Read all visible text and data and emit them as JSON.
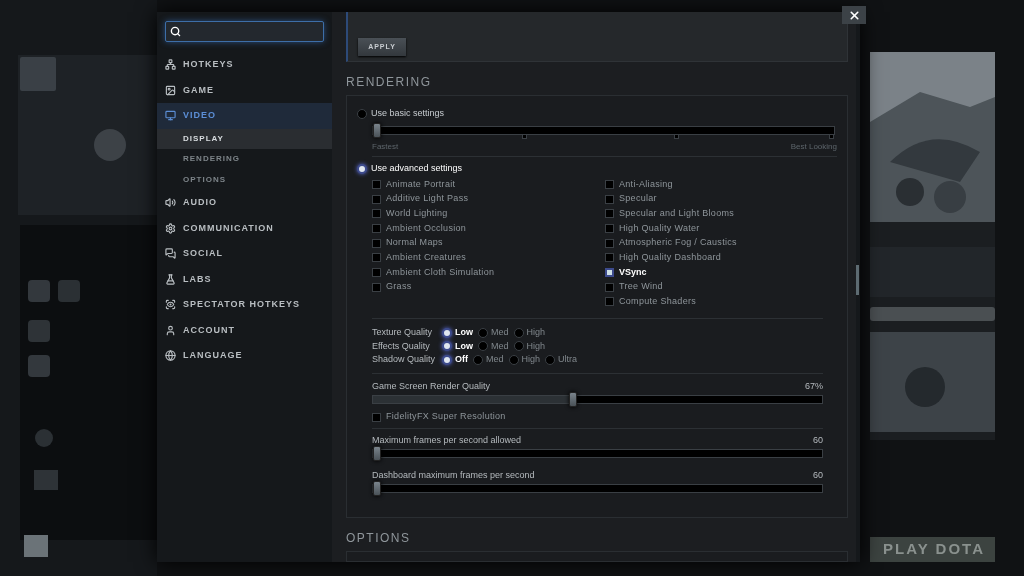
{
  "sidebar": {
    "items": [
      {
        "label": "HOTKEYS",
        "kind": "hotkeys",
        "selected": false
      },
      {
        "label": "GAME",
        "kind": "game",
        "selected": false
      },
      {
        "label": "VIDEO",
        "kind": "video",
        "selected": true,
        "children": [
          {
            "label": "DISPLAY",
            "selected": true
          },
          {
            "label": "RENDERING",
            "selected": false
          },
          {
            "label": "OPTIONS",
            "selected": false
          }
        ]
      },
      {
        "label": "AUDIO",
        "kind": "audio",
        "selected": false
      },
      {
        "label": "COMMUNICATION",
        "kind": "communication",
        "selected": false
      },
      {
        "label": "SOCIAL",
        "kind": "social",
        "selected": false
      },
      {
        "label": "LABS",
        "kind": "labs",
        "selected": false
      },
      {
        "label": "SPECTATOR HOTKEYS",
        "kind": "spectator",
        "selected": false
      },
      {
        "label": "ACCOUNT",
        "kind": "account",
        "selected": false
      },
      {
        "label": "LANGUAGE",
        "kind": "language",
        "selected": false
      }
    ]
  },
  "apply_button": "APPLY",
  "rendering": {
    "title": "RENDERING",
    "basic": {
      "label": "Use basic settings",
      "selected": false,
      "level": 0,
      "min_label": "Fastest",
      "max_label": "Best Looking"
    },
    "advanced": {
      "label": "Use advanced settings",
      "selected": true
    },
    "checkboxes_left": [
      {
        "label": "Animate Portrait",
        "checked": false
      },
      {
        "label": "Additive Light Pass",
        "checked": false
      },
      {
        "label": "World Lighting",
        "checked": false
      },
      {
        "label": "Ambient Occlusion",
        "checked": false
      },
      {
        "label": "Normal Maps",
        "checked": false
      },
      {
        "label": "Ambient Creatures",
        "checked": false
      },
      {
        "label": "Ambient Cloth Simulation",
        "checked": false
      },
      {
        "label": "Grass",
        "checked": false
      }
    ],
    "checkboxes_right": [
      {
        "label": "Anti-Aliasing",
        "checked": false
      },
      {
        "label": "Specular",
        "checked": false
      },
      {
        "label": "Specular and Light Blooms",
        "checked": false
      },
      {
        "label": "High Quality Water",
        "checked": false
      },
      {
        "label": "Atmospheric Fog / Caustics",
        "checked": false
      },
      {
        "label": "High Quality Dashboard",
        "checked": false
      },
      {
        "label": "VSync",
        "checked": true
      },
      {
        "label": "Tree Wind",
        "checked": false
      },
      {
        "label": "Compute Shaders",
        "checked": false
      }
    ],
    "quality": [
      {
        "label": "Texture Quality",
        "options": [
          {
            "label": "Low",
            "selected": true
          },
          {
            "label": "Med",
            "selected": false
          },
          {
            "label": "High",
            "selected": false
          }
        ]
      },
      {
        "label": "Effects Quality",
        "options": [
          {
            "label": "Low",
            "selected": true
          },
          {
            "label": "Med",
            "selected": false
          },
          {
            "label": "High",
            "selected": false
          }
        ]
      },
      {
        "label": "Shadow Quality",
        "options": [
          {
            "label": "Off",
            "selected": true
          },
          {
            "label": "Med",
            "selected": false
          },
          {
            "label": "High",
            "selected": false
          },
          {
            "label": "Ultra",
            "selected": false
          }
        ]
      }
    ],
    "render_quality": {
      "label": "Game Screen Render Quality",
      "reading": "67%",
      "level": 0.445
    },
    "fidelity": {
      "label": "FidelityFX Super Resolution",
      "checked": false
    },
    "fps_sliders": [
      {
        "label": "Maximum frames per second allowed",
        "reading": "60",
        "level": 0
      },
      {
        "label": "Dashboard maximum frames per second",
        "reading": "60",
        "level": 0
      }
    ]
  },
  "options": {
    "title": "OPTIONS"
  },
  "play_button": "PLAY DOTA"
}
